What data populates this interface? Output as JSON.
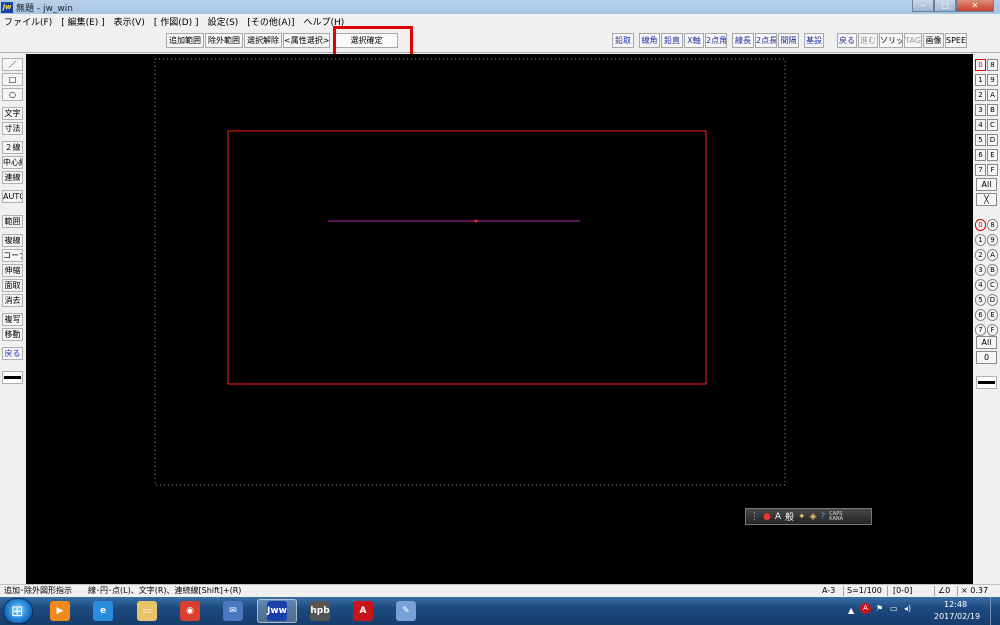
{
  "window": {
    "app_icon_text": "jw",
    "title": "無題 - jw_win",
    "min_icon": "minimize-icon",
    "max_icon": "maximize-icon",
    "close_icon": "close-icon",
    "min_glyph": "─",
    "max_glyph": "□",
    "close_glyph": "✕"
  },
  "menu": [
    "ファイル(F)",
    "[ 編集(E) ]",
    "表示(V)",
    "[ 作図(D) ]",
    "設定(S)",
    "[その他(A)]",
    "ヘルプ(H)"
  ],
  "toolbar": {
    "selection_buttons": [
      "追加範囲",
      "除外範囲",
      "選択解除",
      "<属性選択>",
      "選択確定"
    ],
    "snap_buttons": [
      "鉛取",
      "線角",
      "鉛直",
      "X軸",
      "2点角",
      "線長",
      "2点長",
      "間隔",
      "基設"
    ],
    "right_buttons": [
      "戻る",
      "進む",
      "ソリッド",
      "TAG",
      "画像",
      "SPEED"
    ]
  },
  "left_tools": [
    "／",
    "□",
    "○",
    "文字",
    "寸法",
    "２線",
    "中心線",
    "連線",
    "AUTO",
    "範囲",
    "複線",
    "コーナー",
    "伸縮",
    "面取",
    "消去",
    "複写",
    "移動",
    "戻る"
  ],
  "right_layers": {
    "group_labels": [
      "0",
      "1",
      "2",
      "3",
      "4",
      "5",
      "6",
      "7"
    ],
    "group_labels_hex": [
      "8",
      "9",
      "A",
      "B",
      "C",
      "D",
      "E",
      "F"
    ],
    "all_label": "All",
    "x_label": "╳",
    "layer_labels": [
      "0",
      "1",
      "2",
      "3",
      "4",
      "5",
      "6",
      "7"
    ],
    "layer_labels_hex": [
      "8",
      "9",
      "A",
      "B",
      "C",
      "D",
      "E",
      "F"
    ],
    "all2_label": "All",
    "zero_label": "0"
  },
  "ime": {
    "mode": "A",
    "dictionary": "般",
    "caps": "CAPS",
    "kana": "KANA"
  },
  "status": {
    "prompt": "追加･除外図形指示　　線･円･点(L)、文字(R)、連続線[Shift]+(R)",
    "paper": "A-3",
    "scale": "S=1/100",
    "layer": "[0-0]",
    "angle": "∠0",
    "zoom": "× 0.37"
  },
  "taskbar": {
    "apps": [
      {
        "name": "windows-media-player",
        "icon": "play-icon",
        "label": "▶",
        "color": "#f08a1c"
      },
      {
        "name": "internet-explorer",
        "icon": "ie-icon",
        "label": "e",
        "color": "#2a8ce0"
      },
      {
        "name": "file-explorer",
        "icon": "folder-icon",
        "label": "▭",
        "color": "#e8c36a"
      },
      {
        "name": "chrome",
        "icon": "chrome-icon",
        "label": "◉",
        "color": "#d94030"
      },
      {
        "name": "thunderbird",
        "icon": "mail-icon",
        "label": "✉",
        "color": "#4a78c0"
      },
      {
        "name": "jw-cad",
        "icon": "jw-icon",
        "label": "Jww",
        "color": "#1a3fa8"
      },
      {
        "name": "hpb",
        "icon": "hpb-icon",
        "label": "hpb",
        "color": "#555555"
      },
      {
        "name": "acrobat",
        "icon": "acrobat-icon",
        "label": "A",
        "color": "#c8151b"
      },
      {
        "name": "paint",
        "icon": "paint-icon",
        "label": "✎",
        "color": "#7aa0d8"
      }
    ],
    "time": "12:48",
    "date": "2017/02/19",
    "up_arrow": "▲",
    "flag_glyph": "⚑",
    "monitor_glyph": "▭",
    "volume_glyph": "◂)"
  },
  "colors": {
    "canvas_bg": "#000000",
    "frame_red": "#ff2020",
    "line_magenta": "#b02ab0",
    "highlight": "#e00000"
  }
}
